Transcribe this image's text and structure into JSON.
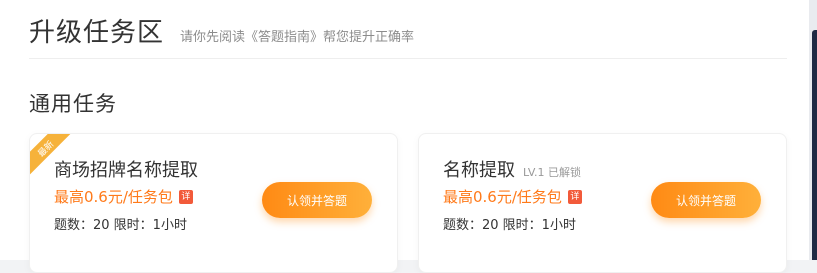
{
  "header": {
    "title": "升级任务区",
    "subtitle": "请你先阅读《答题指南》帮您提升正确率"
  },
  "section": {
    "title": "通用任务"
  },
  "tasks": [
    {
      "badge": "最新",
      "name": "商场招牌名称提取",
      "level": "",
      "reward": "最高0.6元/任务包",
      "detail": "详",
      "meta": "题数：20  限时：1小时",
      "button": "认领并答题"
    },
    {
      "badge": "",
      "name": "名称提取",
      "level": "LV.1 已解锁",
      "reward": "最高0.6元/任务包",
      "detail": "详",
      "meta": "题数：20  限时：1小时",
      "button": "认领并答题"
    }
  ],
  "colors": {
    "accent": "#ff7a1a",
    "ribbon": "#f6b23a",
    "detail_badge": "#f25a3a"
  }
}
